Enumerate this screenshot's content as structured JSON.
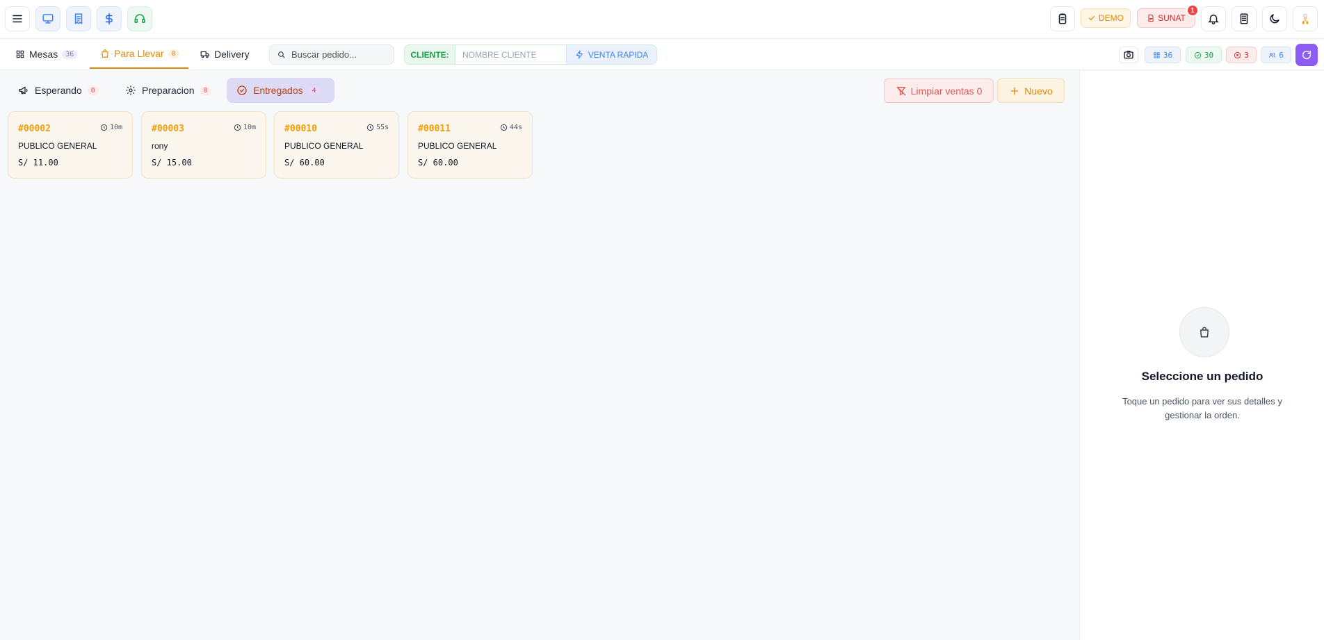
{
  "topbar": {
    "demo_label": "DEMO",
    "sunat_label": "SUNAT",
    "notification_count": "1",
    "accent_color": "#8b5cf6"
  },
  "nav": {
    "tabs": [
      {
        "label": "Mesas",
        "count": "36"
      },
      {
        "label": "Para Llevar",
        "count": "0"
      },
      {
        "label": "Delivery"
      }
    ],
    "search_placeholder": "Buscar pedido...",
    "client_label": "CLIENTE:",
    "client_placeholder": "NOMBRE CLIENTE",
    "venta_rapida_label": "VENTA RAPIDA",
    "stats": [
      {
        "icon": "grid-icon",
        "value": "36",
        "color": "#3b82f6"
      },
      {
        "icon": "check-circle-icon",
        "value": "30",
        "color": "#16a34a"
      },
      {
        "icon": "x-circle-icon",
        "value": "3",
        "color": "#dc2626"
      },
      {
        "icon": "users-icon",
        "value": "6",
        "color": "#3b82f6"
      }
    ]
  },
  "main": {
    "sub_tabs": [
      {
        "label": "Esperando",
        "count": "0"
      },
      {
        "label": "Preparacion",
        "count": "0"
      },
      {
        "label": "Entregados",
        "count": "4"
      }
    ],
    "limpiar_label": "Limpiar ventas 0",
    "nuevo_label": "Nuevo",
    "orders": [
      {
        "number": "#00002",
        "time": "10m",
        "client": "PUBLICO GENERAL",
        "total": "S/ 11.00"
      },
      {
        "number": "#00003",
        "time": "10m",
        "client": "rony",
        "total": "S/ 15.00"
      },
      {
        "number": "#00010",
        "time": "55s",
        "client": "PUBLICO GENERAL",
        "total": "S/ 60.00"
      },
      {
        "number": "#00011",
        "time": "44s",
        "client": "PUBLICO GENERAL",
        "total": "S/ 60.00"
      }
    ]
  },
  "detail": {
    "empty_title": "Seleccione un pedido",
    "empty_desc": "Toque un pedido para ver sus detalles y gestionar la orden."
  }
}
